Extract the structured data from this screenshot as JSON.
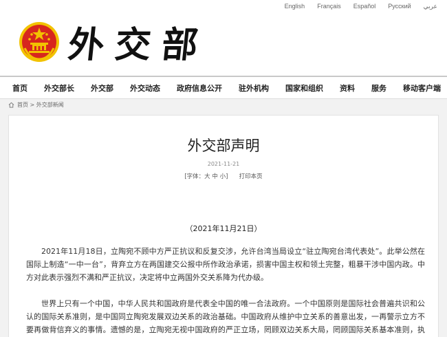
{
  "languages": [
    "English",
    "Français",
    "Español",
    "Русский",
    "عربي"
  ],
  "logo_chars": [
    "外",
    "交",
    "部"
  ],
  "colors": {
    "emblem_red": "#d7261e",
    "emblem_gold": "#f2c200",
    "nav_text": "#222222"
  },
  "nav": [
    "首页",
    "外交部长",
    "外交部",
    "外交动态",
    "政府信息公开",
    "驻外机构",
    "国家和组织",
    "资料",
    "服务",
    "移动客户端"
  ],
  "breadcrumb": {
    "home_icon": "home-icon",
    "home": "首页",
    "sep": " > ",
    "section": "外交部新闻"
  },
  "article": {
    "title": "外交部声明",
    "date": "2021-11-21",
    "font_label": "[字体：",
    "font_large": "大",
    "font_medium": "中",
    "font_small": "小",
    "font_close": "]",
    "print": "打印本页",
    "subtitle": "（2021年11月21日）",
    "paragraphs": [
      "2021年11月18日，立陶宛不顾中方严正抗议和反复交涉，允许台湾当局设立“驻立陶宛台湾代表处”。此举公然在国际上制造“一中一台”，背弃立方在两国建交公报中所作政治承诺，损害中国主权和领土完整，粗暴干涉中国内政。中方对此表示强烈不满和严正抗议，决定将中立两国外交关系降为代办级。",
      "世界上只有一个中国，中华人民共和国政府是代表全中国的唯一合法政府。一个中国原则是国际社会普遍共识和公认的国际关系准则，是中国同立陶宛发展双边关系的政治基础。中国政府从维护中立关系的善意出发，一再警示立方不要再做背信弃义的事情。遗憾的是，立陶宛无视中国政府的严正立场，罔顾双边关系大局，罔顾国际关系基本准则，执意允许以台湾"
    ]
  }
}
